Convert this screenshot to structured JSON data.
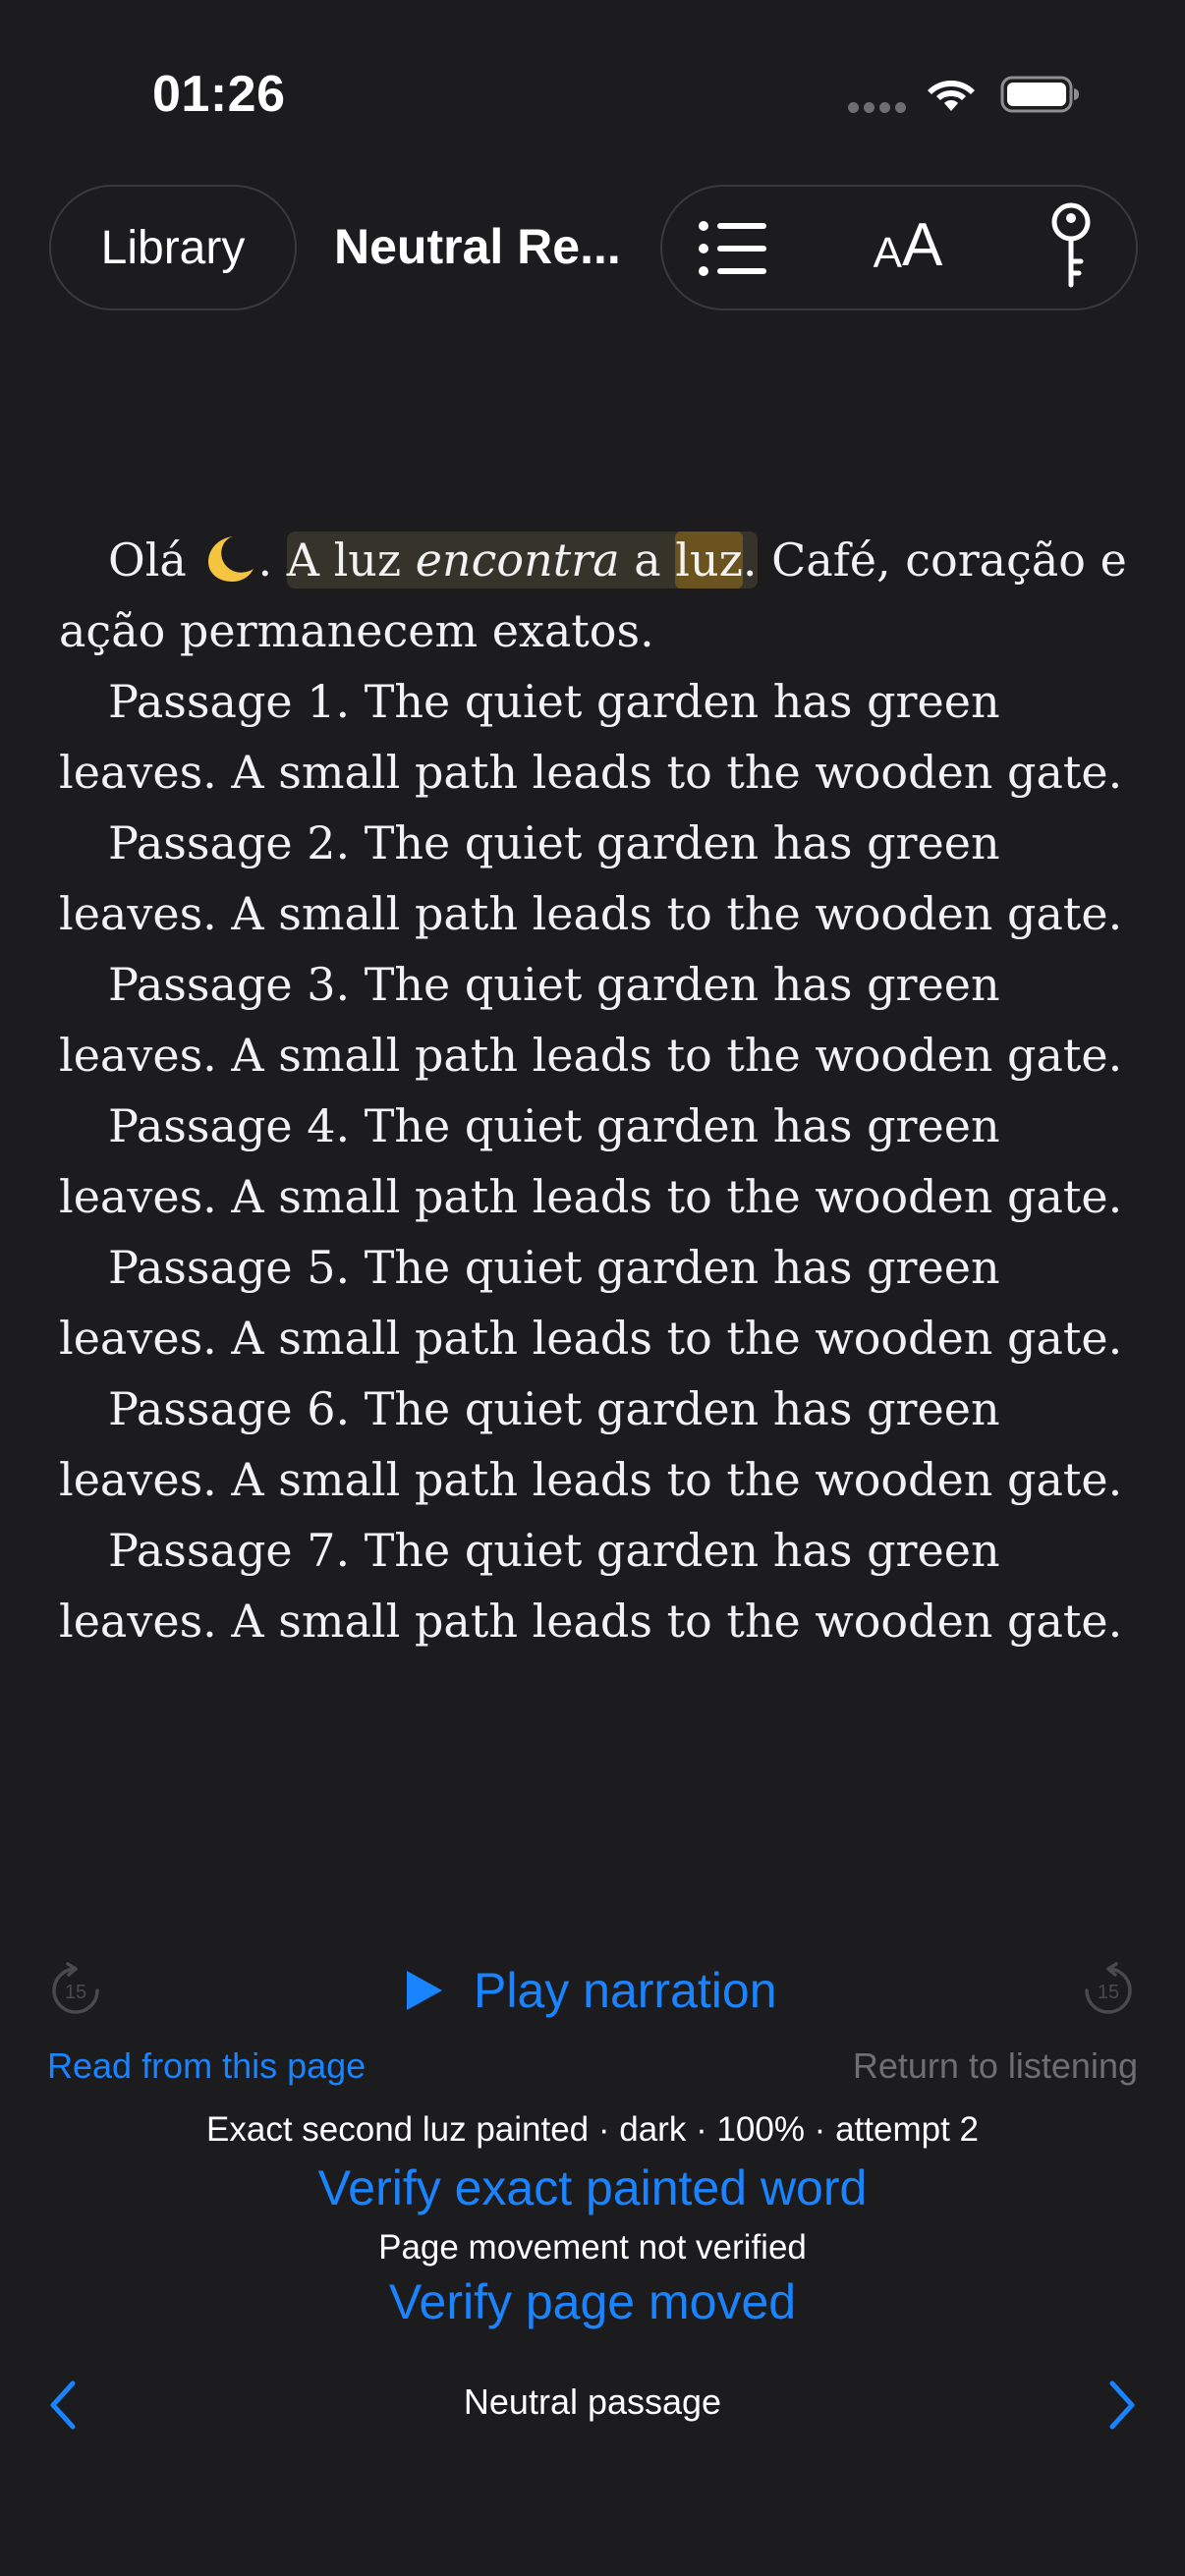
{
  "status_bar": {
    "time": "01:26",
    "icons": [
      "signal-dots-icon",
      "wifi-icon",
      "battery-icon"
    ]
  },
  "nav": {
    "library_label": "Library",
    "title": "Neutral Re...",
    "tools": [
      "table-of-contents-icon",
      "font-size-icon",
      "key-icon"
    ],
    "font_small": "A",
    "font_big": "A"
  },
  "reader": {
    "first_paragraph": {
      "greeting": "Olá",
      "emoji": "crescent-moon",
      "after_emoji": ".",
      "sentence_start": "A luz ",
      "sentence_italic": "encontra",
      "sentence_mid": " a ",
      "highlighted_word": "luz",
      "sentence_end": ".",
      "rest": " Café, coração e ação permanecem exatos."
    },
    "passages": [
      "Passage 1. The quiet garden has green leaves. A small path leads to the wooden gate.",
      "Passage 2. The quiet garden has green leaves. A small path leads to the wooden gate.",
      "Passage 3. The quiet garden has green leaves. A small path leads to the wooden gate.",
      "Passage 4. The quiet garden has green leaves. A small path leads to the wooden gate.",
      "Passage 5. The quiet garden has green leaves. A small path leads to the wooden gate.",
      "Passage 6. The quiet garden has green leaves. A small path leads to the wooden gate.",
      "Passage 7. The quiet garden has green leaves. A small path leads to the wooden gate."
    ]
  },
  "narration": {
    "skip_back_seconds": "15",
    "skip_forward_seconds": "15",
    "play_label": "Play narration",
    "read_from_label": "Read from this page",
    "return_label": "Return to listening"
  },
  "verification": {
    "status_text": "Exact second luz painted · dark · 100% · attempt 2",
    "verify_word_label": "Verify exact painted word",
    "movement_text": "Page movement not verified",
    "verify_page_label": "Verify page moved"
  },
  "page_nav": {
    "label": "Neutral passage"
  },
  "colors": {
    "background": "#1c1c1e",
    "accent": "#1a84ff",
    "sentence_highlight": "#36332b",
    "word_highlight": "#6b5320",
    "disabled": "#6e6e73"
  }
}
